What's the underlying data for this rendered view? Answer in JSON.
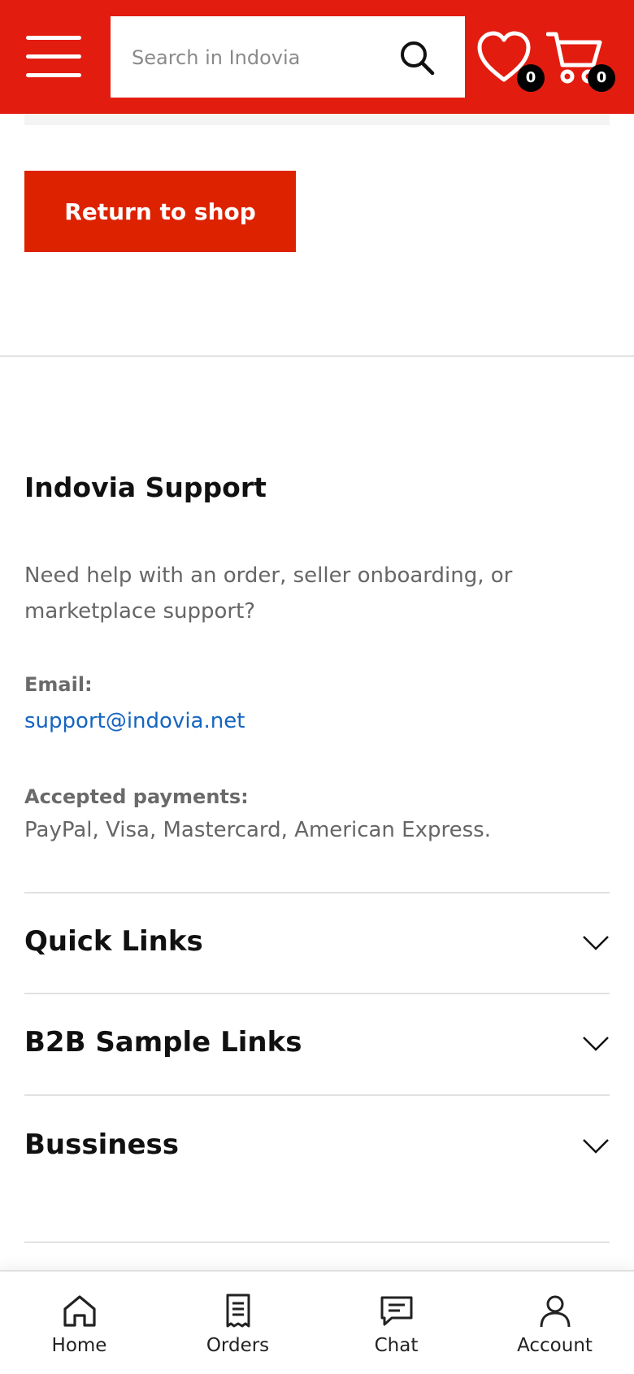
{
  "header": {
    "search_placeholder": "Search in Indovia",
    "wishlist_count": "0",
    "cart_count": "0",
    "brand_color": "#e31c10"
  },
  "main": {
    "return_button": "Return to shop"
  },
  "support": {
    "title": "Indovia Support",
    "description": "Need help with an order, seller onboarding, or marketplace support?",
    "email_label": "Email:",
    "email": "support@indovia.net",
    "payments_label": "Accepted payments:",
    "payments": "PayPal, Visa, Mastercard, American Express."
  },
  "accordions": [
    {
      "label": "Quick Links",
      "expanded": false
    },
    {
      "label": "B2B Sample Links",
      "expanded": false
    },
    {
      "label": "Bussiness",
      "expanded": false
    }
  ],
  "bottom_nav": [
    {
      "label": "Home",
      "icon": "home-icon"
    },
    {
      "label": "Orders",
      "icon": "receipt-icon"
    },
    {
      "label": "Chat",
      "icon": "chat-icon"
    },
    {
      "label": "Account",
      "icon": "user-icon"
    }
  ]
}
